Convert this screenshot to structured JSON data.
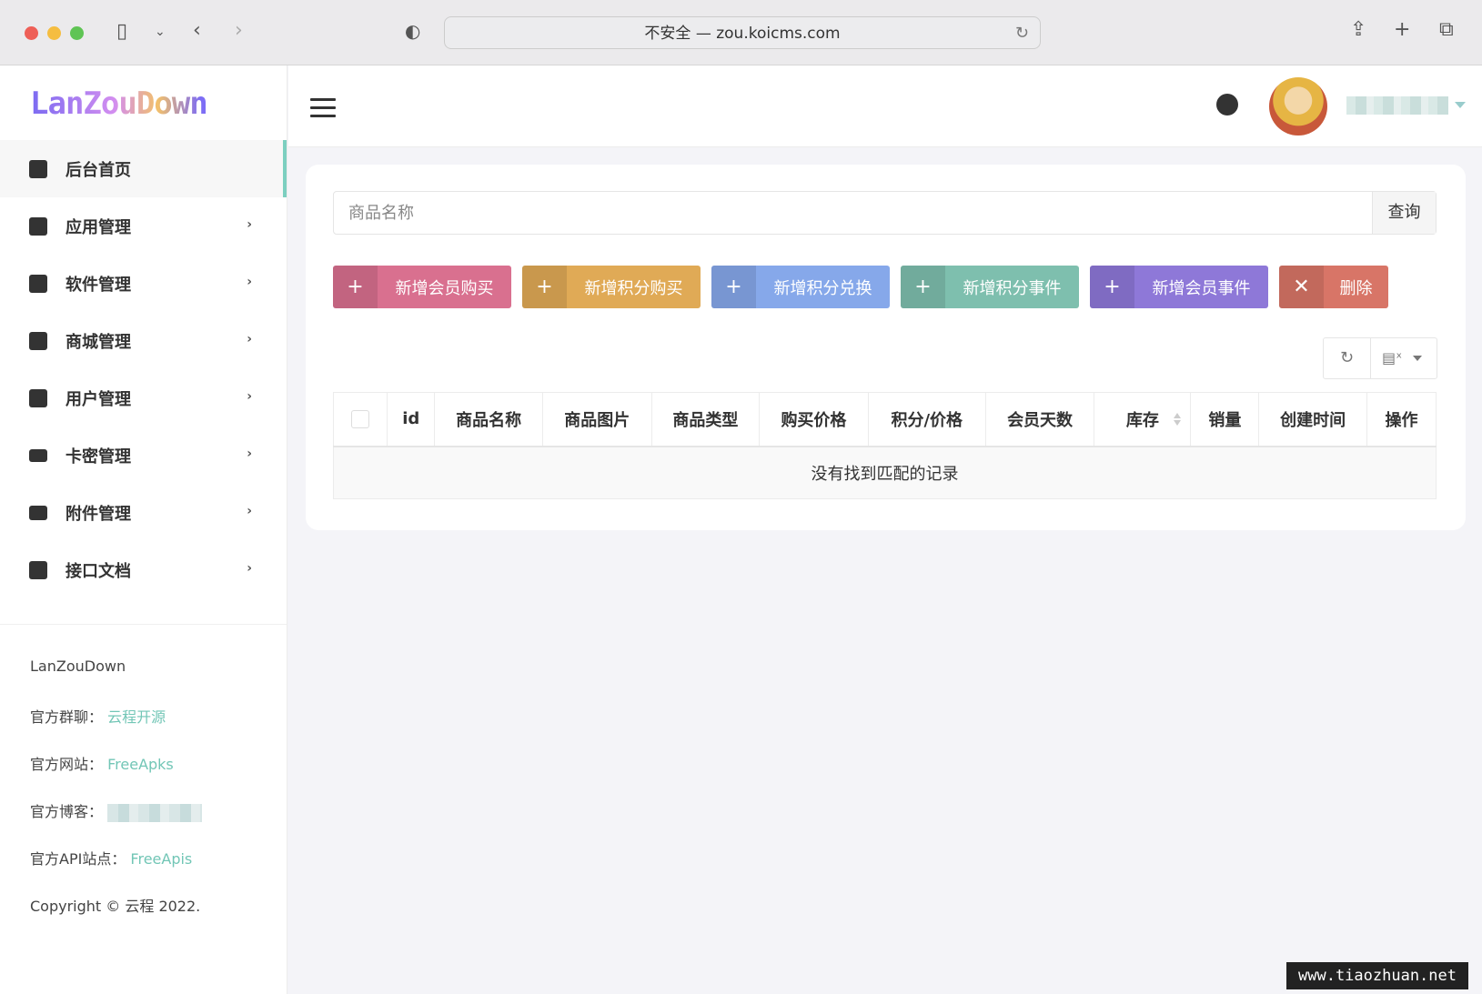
{
  "browser": {
    "url_text": "不安全 — zou.koicms.com"
  },
  "sidebar": {
    "logo": "LanZouDown",
    "items": [
      {
        "label": "后台首页",
        "icon": "home-icon"
      },
      {
        "label": "应用管理",
        "icon": "monitor-icon"
      },
      {
        "label": "软件管理",
        "icon": "infinity-icon"
      },
      {
        "label": "商城管理",
        "icon": "store-icon"
      },
      {
        "label": "用户管理",
        "icon": "user-badge-icon"
      },
      {
        "label": "卡密管理",
        "icon": "card-icon"
      },
      {
        "label": "附件管理",
        "icon": "folder-icon"
      },
      {
        "label": "接口文档",
        "icon": "inbox-icon"
      }
    ],
    "footer": {
      "name": "LanZouDown",
      "group_label": "官方群聊：",
      "group_link": "云程开源",
      "site_label": "官方网站：",
      "site_link": "FreeApks",
      "blog_label": "官方博客：",
      "api_label": "官方API站点：",
      "api_link": "FreeApis",
      "copyright": "Copyright © 云程 2022."
    }
  },
  "search": {
    "placeholder": "商品名称",
    "button": "查询"
  },
  "actions": {
    "plus": "+",
    "cross": "✕",
    "add_vip_purchase": "新增会员购买",
    "add_points_purchase": "新增积分购买",
    "add_points_exchange": "新增积分兑换",
    "add_points_event": "新增积分事件",
    "add_vip_event": "新增会员事件",
    "delete": "删除"
  },
  "colors": {
    "pink": "#d9708f",
    "orange": "#e0aa56",
    "blue": "#86a8ea",
    "teal": "#7ebfae",
    "purple": "#8e78d8",
    "red": "#d87567",
    "accent": "#7ccfc0"
  },
  "table": {
    "columns": [
      "id",
      "商品名称",
      "商品图片",
      "商品类型",
      "购买价格",
      "积分/价格",
      "会员天数",
      "库存",
      "销量",
      "创建时间",
      "操作"
    ],
    "empty_text": "没有找到匹配的记录"
  },
  "watermark": "www.tiaozhuan.net"
}
